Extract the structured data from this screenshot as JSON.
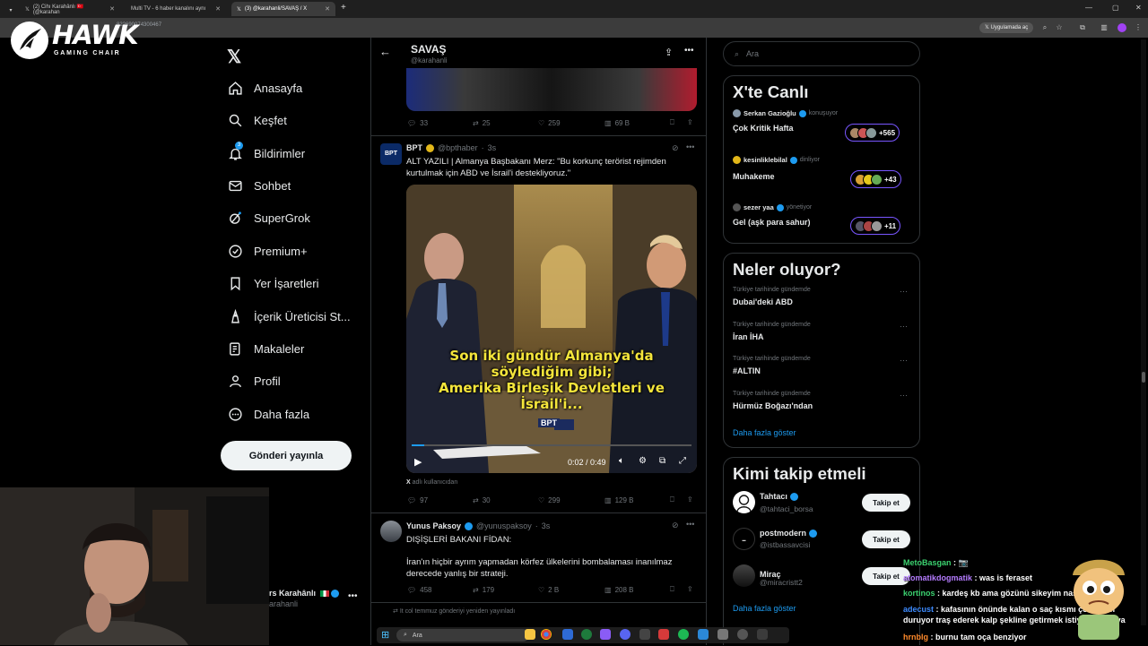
{
  "browser": {
    "tabs": [
      {
        "label": "(2) Cihı Karahânlı 🇹🇷 (@karahan",
        "active": false
      },
      {
        "label": "Multi TV - 6 haber kanalını aynı",
        "active": false
      },
      {
        "label": "(3) @karahanli/SAVAŞ / X",
        "active": true
      }
    ],
    "url_fragment": "822690074300467",
    "app_chip": "Uygulamada aç"
  },
  "overlay_logo": {
    "title": "HAWK",
    "subtitle": "GAMING CHAIR"
  },
  "nav": {
    "items": [
      {
        "label": "Anasayfa",
        "icon": "home-icon"
      },
      {
        "label": "Keşfet",
        "icon": "search-icon"
      },
      {
        "label": "Bildirimler",
        "icon": "bell-icon",
        "badge": "3"
      },
      {
        "label": "Sohbet",
        "icon": "mail-icon"
      },
      {
        "label": "SuperGrok",
        "icon": "grok-icon"
      },
      {
        "label": "Premium+",
        "icon": "verified-icon"
      },
      {
        "label": "Yer İşaretleri",
        "icon": "bookmark-icon"
      },
      {
        "label": "İçerik Üreticisi St...",
        "icon": "creator-icon"
      },
      {
        "label": "Makaleler",
        "icon": "article-icon"
      },
      {
        "label": "Profil",
        "icon": "profile-icon"
      },
      {
        "label": "Daha fazla",
        "icon": "more-circle-icon"
      }
    ],
    "post_button": "Gönderi yayınla",
    "account_name": "rs Karahânlı",
    "account_handle": "arahanli"
  },
  "header": {
    "title": "SAVAŞ",
    "handle": "@karahanli"
  },
  "top_tweet_stats": {
    "replies": "33",
    "retweets": "25",
    "likes": "259",
    "views": "69 B"
  },
  "tweet1": {
    "name": "BPT",
    "handle": "@bpthaber",
    "time": "3s",
    "text_line1": "ALT YAZILI | Almanya Başbakanı Merz: \"Bu korkunç terörist rejimden",
    "text_line2": "kurtulmak için ABD ve İsrail'i destekliyoruz.\"",
    "subtitle_lines": [
      "Son iki gündür Almanya'da",
      "söylediğim gibi;",
      "Amerika Birleşik Devletleri ve",
      "İsrail'i..."
    ],
    "video_time": "0:02 / 0:49",
    "watermark": "BPT",
    "source_prefix": "X",
    "source": "adlı kullanıcıdan",
    "stats": {
      "replies": "97",
      "retweets": "30",
      "likes": "299",
      "views": "129 B"
    }
  },
  "tweet2": {
    "name": "Yunus Paksoy",
    "handle": "@yunuspaksoy",
    "time": "3s",
    "text_line1": "DIŞİŞLERİ BAKANI FİDAN:",
    "text_line2": "İran'ın hiçbir ayrım yapmadan körfez ülkelerini bombalaması inanılmaz",
    "text_line3": "derecede yanlış bir strateji.",
    "stats": {
      "replies": "458",
      "retweets": "179",
      "likes": "2 B",
      "views": "208 B"
    }
  },
  "retweet_note": "It col temmuz gönderiyi yeniden yayınladı",
  "search": {
    "placeholder": "Ara"
  },
  "live": {
    "title": "X'te Canlı",
    "items": [
      {
        "host": "Serkan Gazioğlu",
        "status": "konuşuyor",
        "topic": "Çok Kritik Hafta",
        "count": "+565"
      },
      {
        "host": "kesinliklebilal",
        "status": "dinliyor",
        "topic": "Muhakeme",
        "count": "+43"
      },
      {
        "host": "sezer yaa",
        "status": "yönetiyor",
        "topic": "Gel (aşk para sahur)",
        "count": "+11"
      }
    ]
  },
  "trends": {
    "title": "Neler oluyor?",
    "items": [
      {
        "context": "Türkiye tarihinde gündemde",
        "topic": "Dubai'deki ABD"
      },
      {
        "context": "Türkiye tarihinde gündemde",
        "topic": "İran İHA"
      },
      {
        "context": "Türkiye tarihinde gündemde",
        "topic": "#ALTIN"
      },
      {
        "context": "Türkiye tarihinde gündemde",
        "topic": "Hürmüz Boğazı'ndan"
      }
    ],
    "show_more": "Daha fazla göster"
  },
  "who_to_follow": {
    "title": "Kimi takip etmeli",
    "items": [
      {
        "name": "Tahtacı",
        "handle": "@tahtaci_borsa"
      },
      {
        "name": "postmodern",
        "handle": "@istbassavcisi"
      },
      {
        "name": "Miraç",
        "handle": "@miracristt2"
      }
    ],
    "follow_label": "Takip et",
    "show_more": "Daha fazla göster"
  },
  "chat": [
    {
      "user": "MetoBasgan",
      "message": "📷",
      "color": "#3bd16f"
    },
    {
      "user": "atomatikdogmatik",
      "message": "was is feraset",
      "color": "#b57cff"
    },
    {
      "user": "kortinos",
      "message": "kardeş kb ama gözünü sikeyim nasıl benziyor",
      "color": "#3bd16f"
    },
    {
      "user": "adecust",
      "message": "kafasının önünde kalan o saç kısmı çok güzel duruyor traş ederek kalp şekline getirmek istiyorum oraya",
      "color": "#3d8bff"
    },
    {
      "user": "hrnblg",
      "message": "burnu tam oça benziyor",
      "color": "#ff8a2b"
    }
  ],
  "taskbar": {
    "search_placeholder": "Ara"
  },
  "colors": {
    "accent": "#1d9bf0",
    "verified": "#1d9bf0",
    "live_border": "#7856ff",
    "background": "#000000"
  }
}
